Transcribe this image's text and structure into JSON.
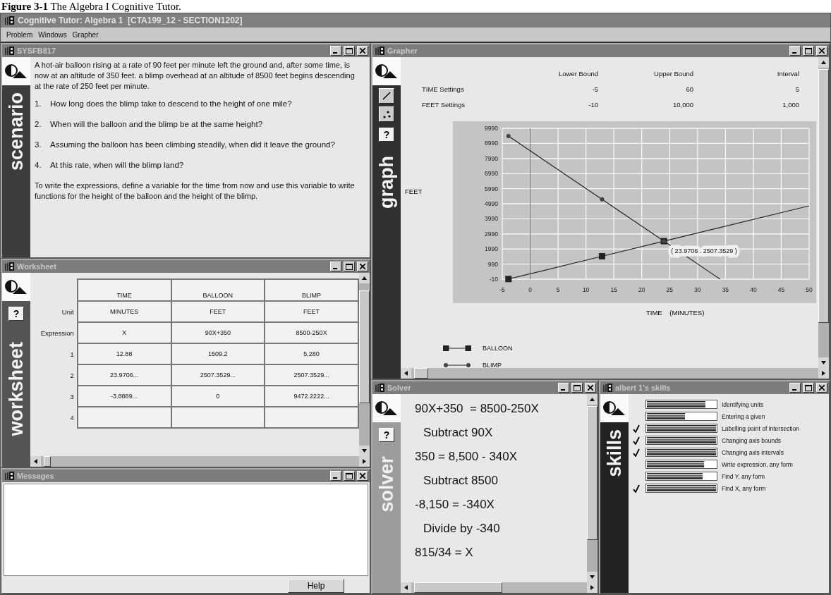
{
  "caption": "**Figure 3-1** The Algebra I Cognitive Tutor.",
  "window": {
    "title": "Cognitive Tutor: Algebra 1  [CTA199_12 - SECTION1202]"
  },
  "menu": [
    "Problem",
    "Windows",
    "Grapher"
  ],
  "scenario": {
    "title": "SYSFB817",
    "side_label": "scenario",
    "intro": "A hot-air balloon rising at a rate of 90 feet per minute left the ground and, after some time,  is now at an altitude of 350 feet.  a blimp overhead at an altitude of 8500 feet begins descending at the rate of 250 feet per minute.",
    "questions": [
      {
        "number": "1.",
        "text": "How long does the blimp take to descend to the height of one mile?"
      },
      {
        "number": "2.",
        "text": "When will the balloon and the blimp be at the same height?"
      },
      {
        "number": "3.",
        "text": "Assuming the balloon has been climbing steadily, when did it leave the ground?"
      },
      {
        "number": "4.",
        "text": "At this rate, when will the blimp land?"
      }
    ],
    "closing": "To write the expressions, define a variable for the time from now and use this variable to write functions for the height of the balloon and the height of the blimp."
  },
  "worksheet": {
    "title": "Worksheet",
    "side_label": "worksheet",
    "help_button": "?",
    "columns": [
      "TIME",
      "BALLOON",
      "BLIMP"
    ],
    "rows": [
      {
        "label": "Unit",
        "cells": [
          "MINUTES",
          "FEET",
          "FEET"
        ]
      },
      {
        "label": "Expression",
        "cells": [
          "X",
          "90X+350",
          "8500-250X"
        ]
      },
      {
        "label": "1",
        "cells": [
          "12.88",
          "1509.2",
          "5,280"
        ]
      },
      {
        "label": "2",
        "cells": [
          "23.9706...",
          "2507.3529...",
          "2507.3529..."
        ]
      },
      {
        "label": "3",
        "cells": [
          "-3.8889...",
          "0",
          "9472.2222..."
        ]
      },
      {
        "label": "4",
        "cells": [
          null,
          null,
          null
        ]
      }
    ]
  },
  "messages": {
    "title": "Messages",
    "help_button": "Help"
  },
  "grapher": {
    "title": "Grapher",
    "side_label": "graph",
    "help_button": "?",
    "settings": {
      "columns": [
        "Lower Bound",
        "Upper Bound",
        "Interval"
      ],
      "rows": [
        {
          "label": "TIME Settings",
          "values": [
            "-5",
            "60",
            "5"
          ]
        },
        {
          "label": "FEET Settings",
          "values": [
            "-10",
            "10,000",
            "1,000"
          ]
        }
      ]
    },
    "y_axis_label": "FEET",
    "x_axis_label": "TIME    (MINUTES)",
    "chart_data": {
      "type": "line",
      "x": [
        -3.89,
        12.88,
        23.97,
        34.04,
        50
      ],
      "grid": true,
      "series": [
        {
          "name": "BALLOON",
          "marker": "square",
          "values": [
            0,
            1509,
            2507,
            null,
            4850
          ]
        },
        {
          "name": "BLIMP",
          "marker": "circle",
          "values": [
            9472,
            5280,
            2507,
            -10,
            null
          ]
        }
      ],
      "xlim": [
        -5,
        50
      ],
      "ylim": [
        -10,
        9990
      ],
      "xticks": [
        -5,
        0,
        5,
        10,
        15,
        20,
        25,
        30,
        35,
        40,
        45,
        50
      ],
      "yticks": [
        -10,
        990,
        1990,
        2990,
        3990,
        4990,
        5990,
        6990,
        7990,
        8990,
        9990
      ],
      "annotations": [
        {
          "x": 23.97,
          "y": 2507,
          "text": "( 23.9706 . 2507.3529 )"
        }
      ]
    }
  },
  "solver": {
    "title": "Solver",
    "side_label": "solver",
    "help_button": "?",
    "steps": [
      {
        "kind": "equation",
        "text": "90X+350  = 8500-250X"
      },
      {
        "kind": "action",
        "text": "Subtract 90X"
      },
      {
        "kind": "equation",
        "text": "350 = 8,500 - 340X"
      },
      {
        "kind": "action",
        "text": "Subtract 8500"
      },
      {
        "kind": "equation",
        "text": "-8,150 = -340X"
      },
      {
        "kind": "action",
        "text": "Divide by -340"
      },
      {
        "kind": "equation",
        "text": "815/34 = X"
      }
    ]
  },
  "skills": {
    "title": "albert 1's skills",
    "side_label": "skills",
    "items": [
      {
        "name": "Identifying units",
        "level": 0.85,
        "mastered": false
      },
      {
        "name": "Entering a given",
        "level": 0.55,
        "mastered": false
      },
      {
        "name": "Labelling point of intersection",
        "level": 1,
        "mastered": true
      },
      {
        "name": "Changing axis bounds",
        "level": 1,
        "mastered": true
      },
      {
        "name": "Changing axis intervals",
        "level": 1,
        "mastered": true
      },
      {
        "name": "Write expression, any form",
        "level": 0.83,
        "mastered": false
      },
      {
        "name": "Find Y, any form",
        "level": 0.81,
        "mastered": false
      },
      {
        "name": "Find X, any form",
        "level": 1,
        "mastered": true
      }
    ]
  }
}
